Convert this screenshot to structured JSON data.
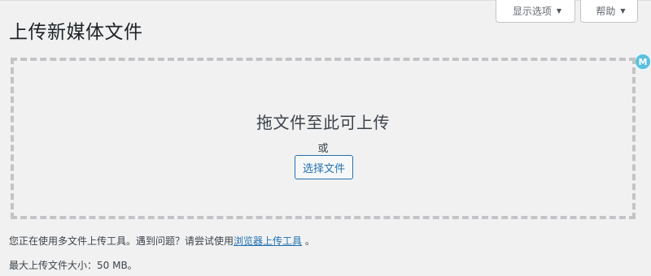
{
  "screen_meta": {
    "screen_options_label": "显示选项",
    "help_label": "帮助",
    "caret": "▼"
  },
  "page": {
    "title": "上传新媒体文件"
  },
  "drop_zone": {
    "instructions": "拖文件至此可上传",
    "or_text": "或",
    "select_button_label": "选择文件"
  },
  "extension_badge": {
    "letter": "M",
    "icon": "extension-badge-icon"
  },
  "notes": {
    "uploader_text": "您正在使用多文件上传工具。遇到问题？请尝试使用",
    "browser_uploader_link": "浏览器上传工具",
    "uploader_suffix": " 。",
    "max_size_text": "最大上传文件大小：50 MB。"
  },
  "colors": {
    "background": "#f1f1f1",
    "link": "#2271b1",
    "dashed_border": "#c3c4c7",
    "badge": "#5bc0de"
  }
}
